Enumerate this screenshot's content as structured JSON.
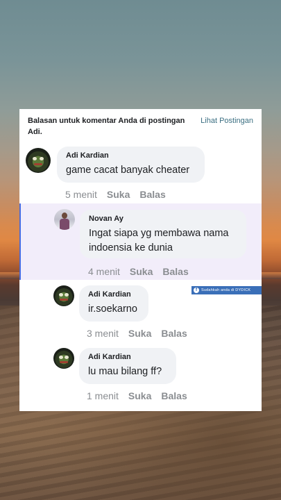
{
  "header": {
    "text": "Balasan untuk komentar Anda di postingan Adi.",
    "link": "Lihat Postingan"
  },
  "comments": [
    {
      "author": "Adi Kardian",
      "text": "game cacat banyak cheater",
      "time": "5 menit",
      "like": "Suka",
      "reply": "Balas",
      "avatar_icon": "frog-avatar-icon"
    },
    {
      "author": "Novan Ay",
      "text_line1": "Ingat siapa yg membawa nama",
      "text_line2": "indoensia ke dunia",
      "time": "4 menit",
      "like": "Suka",
      "reply": "Balas",
      "avatar_icon": "person-avatar-icon"
    },
    {
      "author": "Adi Kardian",
      "text": "ir.soekarno",
      "time": "3 menit",
      "like": "Suka",
      "reply": "Balas",
      "avatar_icon": "frog-avatar-icon"
    },
    {
      "author": "Adi Kardian",
      "text": "lu mau bilang ff?",
      "time": "1 menit",
      "like": "Suka",
      "reply": "Balas",
      "avatar_icon": "frog-avatar-icon"
    }
  ],
  "watermark": {
    "text": "Sudahkah anda di DYDICK"
  },
  "colors": {
    "accent_border": "#4a6ee0",
    "highlight_bg": "#f2edfa",
    "link": "#3b6f82",
    "meta_gray": "#8a8d91"
  }
}
